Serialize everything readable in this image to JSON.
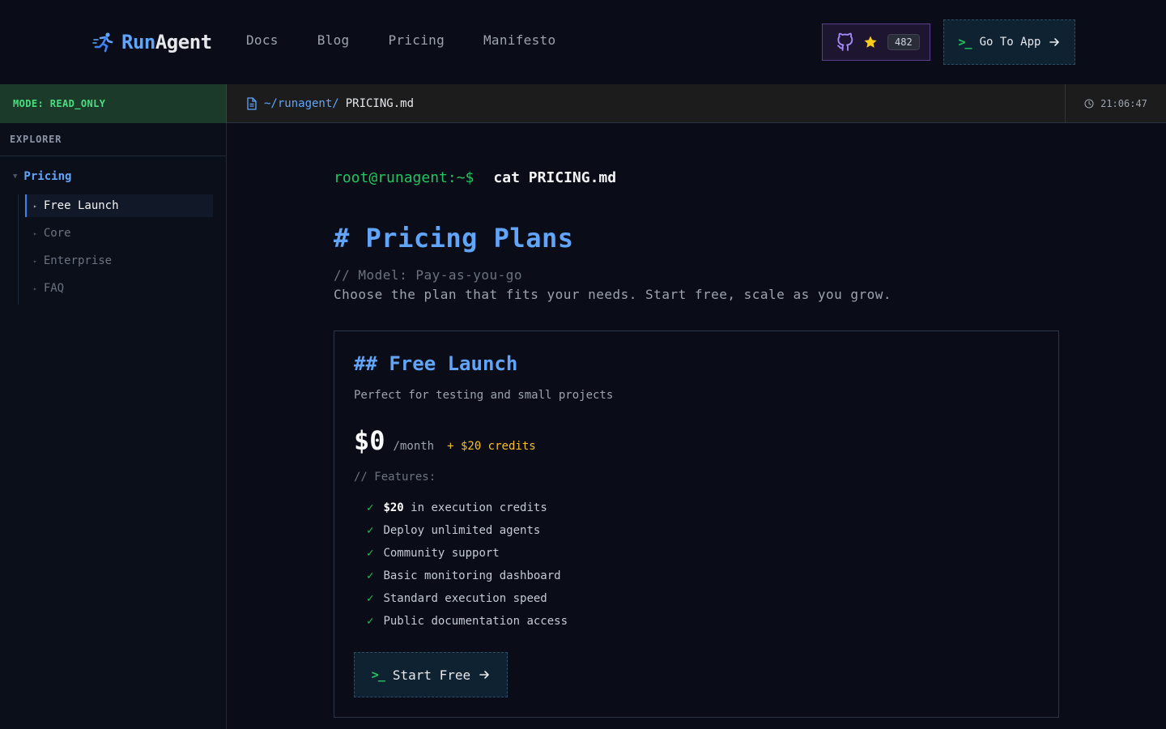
{
  "brand": {
    "run": "Run",
    "agent": "Agent",
    "icon": "running-figure-icon"
  },
  "nav": {
    "items": [
      {
        "label": "Docs"
      },
      {
        "label": "Blog"
      },
      {
        "label": "Pricing"
      },
      {
        "label": "Manifesto"
      }
    ]
  },
  "github": {
    "icon": "github-icon",
    "star_icon": "star-icon",
    "stars": "482"
  },
  "go_app": {
    "prompt": ">_",
    "label": "Go To App",
    "icon": "arrow-right-icon"
  },
  "status": {
    "mode": "MODE: READ_ONLY",
    "path_dir": "~/runagent/",
    "path_file": "PRICING.md",
    "time": "21:06:47"
  },
  "sidebar": {
    "title": "EXPLORER",
    "root": "Pricing",
    "items": [
      {
        "label": "Free Launch",
        "active": true
      },
      {
        "label": "Core"
      },
      {
        "label": "Enterprise"
      },
      {
        "label": "FAQ"
      }
    ]
  },
  "main": {
    "cmd_prompt": "root@runagent:~$",
    "cmd": "cat PRICING.md",
    "title": "# Pricing Plans",
    "model": "// Model: Pay-as-you-go",
    "desc": "Choose the plan that fits your needs. Start free, scale as you grow."
  },
  "plan": {
    "title": "## Free Launch",
    "subtitle": "Perfect for testing and small projects",
    "price": "$0",
    "per": "/month",
    "credits": "+ $20 credits",
    "features_label": "// Features:",
    "feature0_strong": "$20",
    "feature0_rest": "in execution credits",
    "features": [
      "Deploy unlimited agents",
      "Community support",
      "Basic monitoring dashboard",
      "Standard execution speed",
      "Public documentation access"
    ],
    "cta_prompt": ">_",
    "cta": "Start Free"
  },
  "colors": {
    "background": "#0a0d17",
    "accent_blue": "#60a5fa",
    "accent_green": "#22c55e",
    "accent_yellow": "#fbbf24"
  }
}
